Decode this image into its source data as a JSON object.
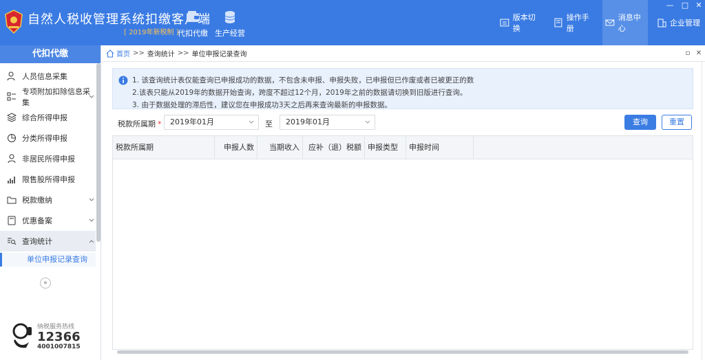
{
  "app": {
    "title": "自然人税收管理系统扣缴客户端",
    "subtitle": "[ 2019年新税制 ]",
    "top_nav": [
      {
        "label": "代扣代缴",
        "icon": "wallet-icon"
      },
      {
        "label": "生产经营",
        "icon": "coins-icon"
      }
    ],
    "right_nav": [
      {
        "label": "版本切换",
        "icon": "switch-icon"
      },
      {
        "label": "操作手册",
        "icon": "book-icon"
      },
      {
        "label": "消息中心",
        "icon": "mail-icon"
      },
      {
        "label": "企业管理",
        "icon": "building-icon"
      }
    ],
    "window_controls": [
      "—",
      "□",
      "✕"
    ]
  },
  "sidebar": {
    "header": "代扣代缴",
    "items": [
      {
        "label": "人员信息采集",
        "icon": "person-icon",
        "has_children": false
      },
      {
        "label": "专项附加扣除信息采集",
        "icon": "grid-icon",
        "has_children": true
      },
      {
        "label": "综合所得申报",
        "icon": "layers-icon",
        "has_children": false
      },
      {
        "label": "分类所得申报",
        "icon": "pie-icon",
        "has_children": false
      },
      {
        "label": "非居民所得申报",
        "icon": "user-icon",
        "has_children": false
      },
      {
        "label": "限售股所得申报",
        "icon": "bar-chart-icon",
        "has_children": false
      },
      {
        "label": "税款缴纳",
        "icon": "folder-icon",
        "has_children": true
      },
      {
        "label": "优惠备案",
        "icon": "document-icon",
        "has_children": true
      },
      {
        "label": "查询统计",
        "icon": "search-list-icon",
        "has_children": true,
        "expanded": true
      }
    ],
    "active_sub": "单位申报记录查询",
    "collapse_glyph": "«",
    "hotline": {
      "title": "纳税服务热线",
      "number": "12366",
      "alt_number": "4001007815"
    }
  },
  "breadcrumb": {
    "home": "首页",
    "separator": ">>",
    "path": [
      "查询统计",
      "单位申报记录查询"
    ]
  },
  "notice": {
    "lines": [
      "1. 该查询统计表仅能查询已申报成功的数据，不包含未申报、申报失败，已申报但已作废或者已被更正的数",
      "2.该表只能从2019年的数据开始查询，跨度不超过12个月，2019年之前的数据请切换到旧版进行查询。",
      "3. 由于数据处理的滞后性，建议您在申报成功3天之后再来查询最新的申报数据。"
    ]
  },
  "filter": {
    "label": "税款所属期",
    "required_mark": "*",
    "from": "2019年01月",
    "to_label": "至",
    "to": "2019年01月",
    "query_button": "查询",
    "reset_button": "重置"
  },
  "table": {
    "columns": [
      "税款所属期",
      "申报人数",
      "当期收入",
      "应补（退）税额",
      "申报类型",
      "申报时间"
    ],
    "rows": []
  },
  "colors": {
    "header_bg": "#3a7be3",
    "accent": "#3b7de3",
    "subtitle": "#f7c25a",
    "notice_bg": "#e8f1fc"
  }
}
